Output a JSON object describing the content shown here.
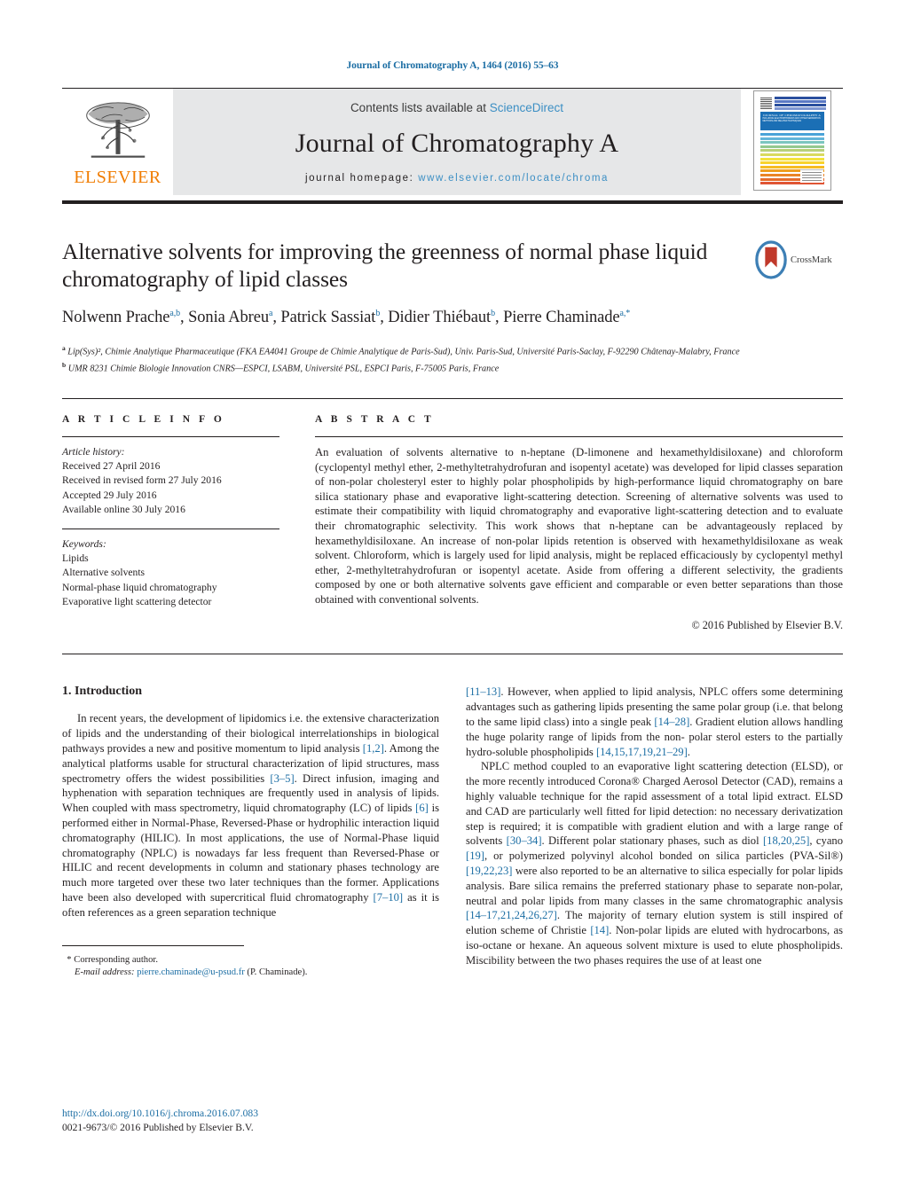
{
  "running_head": "Journal of Chromatography A, 1464 (2016) 55–63",
  "journal_header": {
    "contents_prefix": "Contents lists available at ",
    "sciencedirect": "ScienceDirect",
    "journal_title": "Journal of Chromatography A",
    "homepage_prefix": "journal homepage: ",
    "homepage_url": "www.elsevier.com/locate/chroma",
    "publisher": "ELSEVIER",
    "cover_title": "JOURNAL OF CHROMATOGRAPHY A",
    "cover_subtitle": "INCLUDING ELECTROPHORESIS AND OTHER SEPARATION METHODS AND RELATED TECHNIQUES",
    "accent_link_color": "#3c8fc4",
    "band_color": "#e6e7e8",
    "elsevier_orange": "#f07c00"
  },
  "title": "Alternative solvents for improving the greenness of normal phase liquid chromatography of lipid classes",
  "crossmark": {
    "label": "CrossMark"
  },
  "authors": [
    {
      "name": "Nolwenn Prache",
      "marks": "a,b",
      "sep": ", "
    },
    {
      "name": "Sonia Abreu",
      "marks": "a",
      "sep": ", "
    },
    {
      "name": "Patrick Sassiat",
      "marks": "b",
      "sep": ", "
    },
    {
      "name": "Didier Thiébaut",
      "marks": "b",
      "sep": ", "
    },
    {
      "name": "Pierre Chaminade",
      "marks": "a,*",
      "sep": ""
    }
  ],
  "affiliations": [
    {
      "mark": "a",
      "text": "Lip(Sys)², Chimie Analytique Pharmaceutique (FKA EA4041 Groupe de Chimie Analytique de Paris-Sud), Univ. Paris-Sud, Université Paris-Saclay, F-92290 Châtenay-Malabry, France"
    },
    {
      "mark": "b",
      "text": "UMR 8231 Chimie Biologie Innovation CNRS—ESPCI, LSABM, Université PSL, ESPCI Paris, F-75005 Paris, France"
    }
  ],
  "article_info": {
    "label": "A R T I C L E   I N F O",
    "history_label": "Article history:",
    "history": [
      "Received 27 April 2016",
      "Received in revised form 27 July 2016",
      "Accepted 29 July 2016",
      "Available online 30 July 2016"
    ],
    "keywords_label": "Keywords:",
    "keywords": [
      "Lipids",
      "Alternative solvents",
      "Normal-phase liquid chromatography",
      "Evaporative light scattering detector"
    ]
  },
  "abstract": {
    "label": "A B S T R A C T",
    "text": "An evaluation of solvents alternative to n-heptane (D-limonene and hexamethyldisiloxane) and chloroform (cyclopentyl methyl ether, 2-methyltetrahydrofuran and isopentyl acetate) was developed for lipid classes separation of non-polar cholesteryl ester to highly polar phospholipids by high-performance liquid chromatography on bare silica stationary phase and evaporative light-scattering detection. Screening of alternative solvents was used to estimate their compatibility with liquid chromatography and evaporative light-scattering detection and to evaluate their chromatographic selectivity. This work shows that n-heptane can be advantageously replaced by hexamethyldisiloxane. An increase of non-polar lipids retention is observed with hexamethyldisiloxane as weak solvent. Chloroform, which is largely used for lipid analysis, might be replaced efficaciously by cyclopentyl methyl ether, 2-methyltetrahydrofuran or isopentyl acetate. Aside from offering a different selectivity, the gradients composed by one or both alternative solvents gave efficient and comparable or even better separations than those obtained with conventional solvents.",
    "copyright": "© 2016 Published by Elsevier B.V."
  },
  "introduction": {
    "heading": "1.  Introduction",
    "left_paragraphs": [
      "In recent years, the development of lipidomics i.e. the extensive characterization of lipids and the understanding of their biological interrelationships in biological pathways provides a new and positive momentum to lipid analysis [1,2]. Among the analytical platforms usable for structural characterization of lipid structures, mass spectrometry offers the widest possibilities [3–5]. Direct infusion, imaging and hyphenation with separation techniques are frequently used in analysis of lipids. When coupled with mass spectrometry, liquid chromatography (LC) of lipids [6] is performed either in Normal-Phase, Reversed-Phase or hydrophilic interaction liquid chromatography (HILIC). In most applications, the use of Normal-Phase liquid chromatography (NPLC) is nowadays far less frequent than Reversed-Phase or HILIC and recent developments in column and stationary phases technology are much more targeted over these two later techniques than the former. Applications have been also developed with supercritical fluid chromatography [7–10] as it is often references as a green separation technique"
    ],
    "right_paragraphs": [
      "[11–13]. However, when applied to lipid analysis, NPLC offers some determining advantages such as gathering lipids presenting the same polar group (i.e. that belong to the same lipid class) into a single peak [14–28]. Gradient elution allows handling the huge polarity range of lipids from the non- polar sterol esters to the partially hydro-soluble phospholipids [14,15,17,19,21–29].",
      "NPLC method coupled to an evaporative light scattering detection (ELSD), or the more recently introduced Corona® Charged Aerosol Detector (CAD), remains a highly valuable technique for the rapid assessment of a total lipid extract. ELSD and CAD are particularly well fitted for lipid detection: no necessary derivatization step is required; it is compatible with gradient elution and with a large range of solvents [30–34]. Different polar stationary phases, such as diol [18,20,25], cyano [19], or polymerized polyvinyl alcohol bonded on silica particles (PVA-Sil®) [19,22,23] were also reported to be an alternative to silica especially for polar lipids analysis. Bare silica remains the preferred stationary phase to separate non-polar, neutral and polar lipids from many classes in the same chromatographic analysis [14–17,21,24,26,27]. The majority of ternary elution system is still inspired of elution scheme of Christie [14]. Non-polar lipids are eluted with hydrocarbons, as iso-octane or hexane. An aqueous solvent mixture is used to elute phospholipids. Miscibility between the two phases requires the use of at least one"
    ]
  },
  "footnote": {
    "star": "*",
    "corresponding": "Corresponding author.",
    "email_label": "E-mail address:",
    "email": "pierre.chaminade@u-psud.fr",
    "email_suffix": "(P. Chaminade)."
  },
  "doi": {
    "url": "http://dx.doi.org/10.1016/j.chroma.2016.07.083",
    "issn_line": "0021-9673/© 2016 Published by Elsevier B.V."
  }
}
